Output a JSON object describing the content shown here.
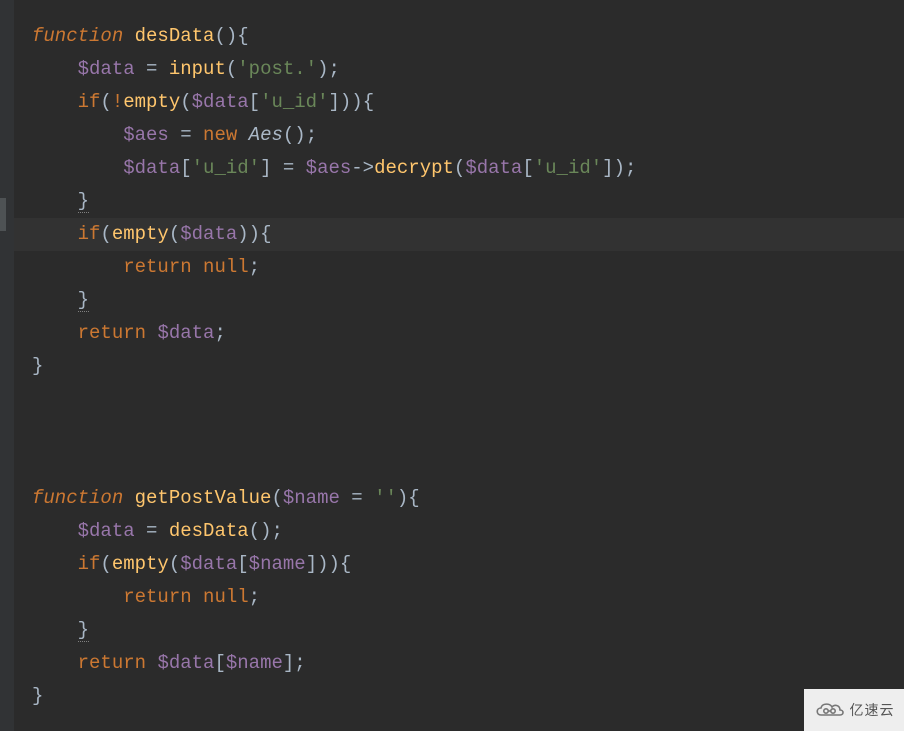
{
  "editor": {
    "language": "php",
    "theme": "darcula",
    "current_line_index": 6,
    "tokens": [
      [
        {
          "t": "function",
          "c": "kw-it"
        },
        {
          "t": " ",
          "c": "punc"
        },
        {
          "t": "desData",
          "c": "fn-def"
        },
        {
          "t": "(){",
          "c": "punc"
        }
      ],
      [
        {
          "t": "    ",
          "c": "punc"
        },
        {
          "t": "$data",
          "c": "var"
        },
        {
          "t": " = ",
          "c": "punc"
        },
        {
          "t": "input",
          "c": "fn-call"
        },
        {
          "t": "(",
          "c": "punc"
        },
        {
          "t": "'post.'",
          "c": "str"
        },
        {
          "t": ");",
          "c": "punc"
        }
      ],
      [
        {
          "t": "    ",
          "c": "punc"
        },
        {
          "t": "if",
          "c": "kw"
        },
        {
          "t": "(",
          "c": "punc"
        },
        {
          "t": "!",
          "c": "kw"
        },
        {
          "t": "empty",
          "c": "fn-call"
        },
        {
          "t": "(",
          "c": "punc"
        },
        {
          "t": "$data",
          "c": "var"
        },
        {
          "t": "[",
          "c": "punc"
        },
        {
          "t": "'u_id'",
          "c": "str"
        },
        {
          "t": "])){",
          "c": "punc"
        }
      ],
      [
        {
          "t": "        ",
          "c": "punc"
        },
        {
          "t": "$aes",
          "c": "var"
        },
        {
          "t": " = ",
          "c": "punc"
        },
        {
          "t": "new",
          "c": "kw"
        },
        {
          "t": " ",
          "c": "punc"
        },
        {
          "t": "Aes",
          "c": "cls"
        },
        {
          "t": "();",
          "c": "punc"
        }
      ],
      [
        {
          "t": "        ",
          "c": "punc"
        },
        {
          "t": "$data",
          "c": "var"
        },
        {
          "t": "[",
          "c": "punc"
        },
        {
          "t": "'u_id'",
          "c": "str"
        },
        {
          "t": "] = ",
          "c": "punc"
        },
        {
          "t": "$aes",
          "c": "var"
        },
        {
          "t": "->",
          "c": "arrow"
        },
        {
          "t": "decrypt",
          "c": "fn-call"
        },
        {
          "t": "(",
          "c": "punc"
        },
        {
          "t": "$data",
          "c": "var"
        },
        {
          "t": "[",
          "c": "punc"
        },
        {
          "t": "'u_id'",
          "c": "str"
        },
        {
          "t": "]);",
          "c": "punc"
        }
      ],
      [
        {
          "t": "    ",
          "c": "punc"
        },
        {
          "t": "}",
          "c": "punc underline-warn"
        }
      ],
      [
        {
          "t": "    ",
          "c": "punc"
        },
        {
          "t": "if",
          "c": "kw"
        },
        {
          "t": "(",
          "c": "punc"
        },
        {
          "t": "empty",
          "c": "fn-call"
        },
        {
          "t": "(",
          "c": "punc"
        },
        {
          "t": "$data",
          "c": "var"
        },
        {
          "t": ")){",
          "c": "punc"
        }
      ],
      [
        {
          "t": "        ",
          "c": "punc"
        },
        {
          "t": "return",
          "c": "kw"
        },
        {
          "t": " ",
          "c": "punc"
        },
        {
          "t": "null",
          "c": "kw"
        },
        {
          "t": ";",
          "c": "punc"
        }
      ],
      [
        {
          "t": "    ",
          "c": "punc"
        },
        {
          "t": "}",
          "c": "punc underline-warn"
        }
      ],
      [
        {
          "t": "    ",
          "c": "punc"
        },
        {
          "t": "return",
          "c": "kw"
        },
        {
          "t": " ",
          "c": "punc"
        },
        {
          "t": "$data",
          "c": "var"
        },
        {
          "t": ";",
          "c": "punc"
        }
      ],
      [
        {
          "t": "}",
          "c": "punc"
        }
      ],
      [],
      [],
      [],
      [
        {
          "t": "function",
          "c": "kw-it"
        },
        {
          "t": " ",
          "c": "punc"
        },
        {
          "t": "getPostValue",
          "c": "fn-def"
        },
        {
          "t": "(",
          "c": "punc"
        },
        {
          "t": "$name",
          "c": "var"
        },
        {
          "t": " = ",
          "c": "punc"
        },
        {
          "t": "''",
          "c": "str"
        },
        {
          "t": "){",
          "c": "punc"
        }
      ],
      [
        {
          "t": "    ",
          "c": "punc"
        },
        {
          "t": "$data",
          "c": "var"
        },
        {
          "t": " = ",
          "c": "punc"
        },
        {
          "t": "desData",
          "c": "fn-call"
        },
        {
          "t": "();",
          "c": "punc"
        }
      ],
      [
        {
          "t": "    ",
          "c": "punc"
        },
        {
          "t": "if",
          "c": "kw"
        },
        {
          "t": "(",
          "c": "punc"
        },
        {
          "t": "empty",
          "c": "fn-call"
        },
        {
          "t": "(",
          "c": "punc"
        },
        {
          "t": "$data",
          "c": "var"
        },
        {
          "t": "[",
          "c": "punc"
        },
        {
          "t": "$name",
          "c": "var"
        },
        {
          "t": "])){",
          "c": "punc"
        }
      ],
      [
        {
          "t": "        ",
          "c": "punc"
        },
        {
          "t": "return",
          "c": "kw"
        },
        {
          "t": " ",
          "c": "punc"
        },
        {
          "t": "null",
          "c": "kw"
        },
        {
          "t": ";",
          "c": "punc"
        }
      ],
      [
        {
          "t": "    ",
          "c": "punc"
        },
        {
          "t": "}",
          "c": "punc underline-warn"
        }
      ],
      [
        {
          "t": "    ",
          "c": "punc"
        },
        {
          "t": "return",
          "c": "kw"
        },
        {
          "t": " ",
          "c": "punc"
        },
        {
          "t": "$data",
          "c": "var"
        },
        {
          "t": "[",
          "c": "punc"
        },
        {
          "t": "$name",
          "c": "var"
        },
        {
          "t": "];",
          "c": "punc"
        }
      ],
      [
        {
          "t": "}",
          "c": "punc"
        }
      ]
    ]
  },
  "watermark": {
    "text": "亿速云",
    "icon": "cloud-logo-icon"
  }
}
